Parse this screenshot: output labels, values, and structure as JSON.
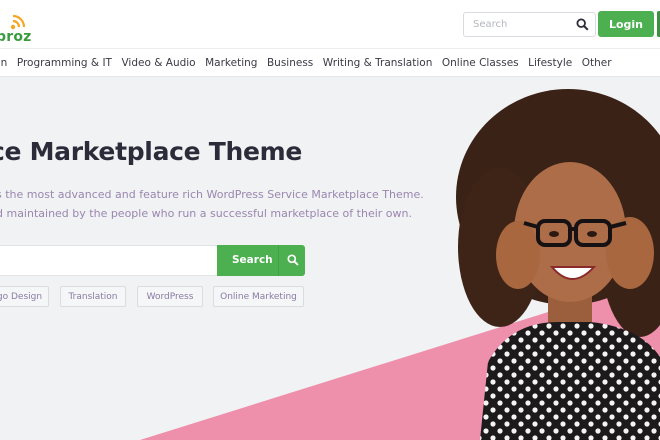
{
  "header": {
    "logo_text": "proz",
    "search_placeholder": "Search",
    "login_label": "Login"
  },
  "categories": [
    "gn",
    "Programming & IT",
    "Video & Audio",
    "Marketing",
    "Business",
    "Writing & Translation",
    "Online Classes",
    "Lifestyle",
    "Other"
  ],
  "hero": {
    "title": "ce Marketplace Theme",
    "subtitle_line1": "s the most advanced and feature rich WordPress Service Marketplace Theme.",
    "subtitle_line2": "d maintained by the people who run a successful marketplace of their own.",
    "search_button": "Search",
    "tags": [
      "go Design",
      "Translation",
      "WordPress",
      "Online Marketing"
    ]
  },
  "colors": {
    "brand_green": "#4caf50",
    "pink_accent": "#ee8fab",
    "title_text": "#2b2b39",
    "subtitle_text": "#9a86b0"
  }
}
